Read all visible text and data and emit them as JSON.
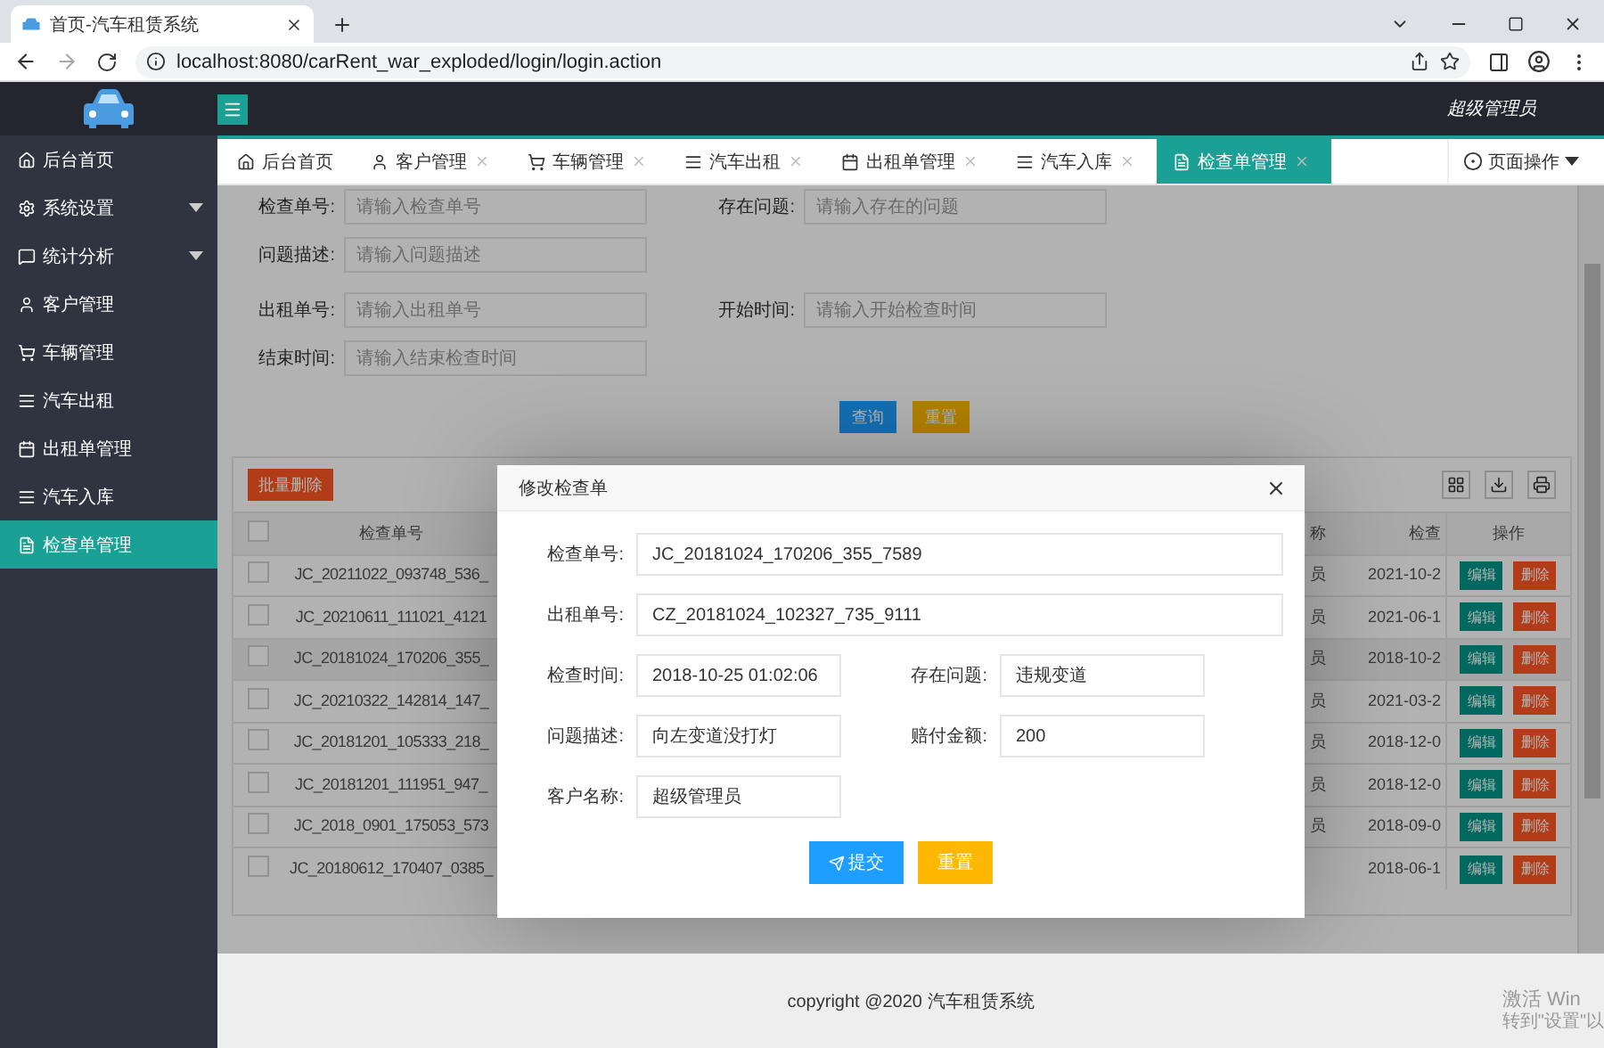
{
  "browser": {
    "tab_title": "首页-汽车租赁系统",
    "url": "localhost:8080/carRent_war_exploded/login/login.action"
  },
  "header": {
    "user": "超级管理员"
  },
  "sidebar": {
    "items": [
      {
        "label": "后台首页",
        "expandable": false,
        "selected": false
      },
      {
        "label": "系统设置",
        "expandable": true,
        "selected": false
      },
      {
        "label": "统计分析",
        "expandable": true,
        "selected": false
      },
      {
        "label": "客户管理",
        "expandable": false,
        "selected": false
      },
      {
        "label": "车辆管理",
        "expandable": false,
        "selected": false
      },
      {
        "label": "汽车出租",
        "expandable": false,
        "selected": false
      },
      {
        "label": "出租单管理",
        "expandable": false,
        "selected": false
      },
      {
        "label": "汽车入库",
        "expandable": false,
        "selected": false
      },
      {
        "label": "检查单管理",
        "expandable": false,
        "selected": true
      }
    ]
  },
  "tabs": [
    {
      "label": "后台首页",
      "closable": false,
      "selected": false
    },
    {
      "label": "客户管理",
      "closable": true,
      "selected": false
    },
    {
      "label": "车辆管理",
      "closable": true,
      "selected": false
    },
    {
      "label": "汽车出租",
      "closable": true,
      "selected": false
    },
    {
      "label": "出租单管理",
      "closable": true,
      "selected": false
    },
    {
      "label": "汽车入库",
      "closable": true,
      "selected": false
    },
    {
      "label": "检查单管理",
      "closable": true,
      "selected": true
    }
  ],
  "page_actions": "页面操作",
  "search": {
    "groups": [
      [
        [
          {
            "label": "检查单号:",
            "placeholder": "请输入检查单号"
          },
          {
            "label": "存在问题:",
            "placeholder": "请输入存在的问题"
          }
        ],
        [
          {
            "label": "问题描述:",
            "placeholder": "请输入问题描述"
          }
        ]
      ],
      [
        [
          {
            "label": "出租单号:",
            "placeholder": "请输入出租单号"
          },
          {
            "label": "开始时间:",
            "placeholder": "请输入开始检查时间"
          }
        ],
        [
          {
            "label": "结束时间:",
            "placeholder": "请输入结束检查时间"
          }
        ]
      ]
    ],
    "buttons": [
      {
        "label": "查询",
        "kind": "primary"
      },
      {
        "label": "重置",
        "kind": "warn"
      }
    ]
  },
  "table": {
    "batch_delete": "批量删除",
    "header_checked": false,
    "columns": [
      "检查单号",
      "称",
      "检查",
      "操作"
    ],
    "rows": [
      {
        "checked": false,
        "selected": false,
        "number": "JC_20211022_093748_536_",
        "column_3": "员",
        "date": "2021-10-2",
        "actions": [
          "编辑",
          "删除"
        ]
      },
      {
        "checked": false,
        "selected": false,
        "number": "JC_20210611_111021_4121",
        "column_3": "员",
        "date": "2021-06-1",
        "actions": [
          "编辑",
          "删除"
        ]
      },
      {
        "checked": false,
        "selected": true,
        "number": "JC_20181024_170206_355_",
        "column_3": "员",
        "date": "2018-10-2",
        "actions": [
          "编辑",
          "删除"
        ]
      },
      {
        "checked": false,
        "selected": false,
        "number": "JC_20210322_142814_147_",
        "column_3": "员",
        "date": "2021-03-2",
        "actions": [
          "编辑",
          "删除"
        ]
      },
      {
        "checked": false,
        "selected": false,
        "number": "JC_20181201_105333_218_",
        "column_3": "员",
        "date": "2018-12-0",
        "actions": [
          "编辑",
          "删除"
        ]
      },
      {
        "checked": false,
        "selected": false,
        "number": "JC_20181201_111951_947_",
        "column_3": "员",
        "date": "2018-12-0",
        "actions": [
          "编辑",
          "删除"
        ]
      },
      {
        "checked": false,
        "selected": false,
        "number": "JC_2018_0901_175053_573",
        "column_3": "员",
        "date": "2018-09-0",
        "actions": [
          "编辑",
          "删除"
        ]
      },
      {
        "checked": false,
        "selected": false,
        "number": "JC_20180612_170407_0385_",
        "date": "2018-06-1",
        "actions": [
          "编辑",
          "删除"
        ]
      }
    ]
  },
  "modal": {
    "title": "修改检查单",
    "fields": [
      {
        "label": "检查单号:",
        "value": "JC_20181024_170206_355_7589",
        "kind": "wide"
      },
      {
        "label": "出租单号:",
        "value": "CZ_20181024_102327_735_9111",
        "kind": "wide"
      },
      {
        "label": "检查时间:",
        "value": "2018-10-25 01:02:06",
        "kind": "half"
      },
      {
        "label": "存在问题:",
        "value": "违规变道",
        "kind": "half"
      },
      {
        "label": "问题描述:",
        "value": "向左变道没打灯",
        "kind": "half"
      },
      {
        "label": "赔付金额:",
        "value": "200",
        "kind": "half"
      },
      {
        "label": "客户名称:",
        "value": "超级管理员",
        "kind": "half"
      }
    ],
    "buttons": [
      {
        "label": "提交",
        "kind": "primary"
      },
      {
        "label": "重置",
        "kind": "warn"
      }
    ]
  },
  "footer": "copyright @2020 汽车租赁系统",
  "os_notice": {
    "title": "激活 Win",
    "hint": "转到\"设置\"以"
  }
}
